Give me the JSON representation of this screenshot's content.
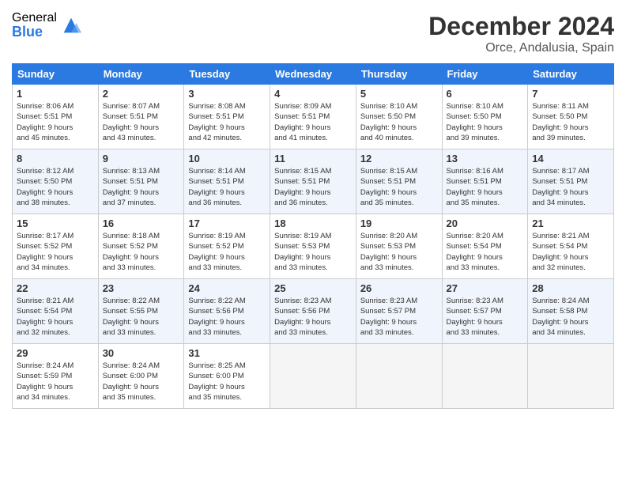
{
  "logo": {
    "general": "General",
    "blue": "Blue"
  },
  "header": {
    "month": "December 2024",
    "location": "Orce, Andalusia, Spain"
  },
  "weekdays": [
    "Sunday",
    "Monday",
    "Tuesday",
    "Wednesday",
    "Thursday",
    "Friday",
    "Saturday"
  ],
  "weeks": [
    [
      {
        "day": "1",
        "info": "Sunrise: 8:06 AM\nSunset: 5:51 PM\nDaylight: 9 hours\nand 45 minutes."
      },
      {
        "day": "2",
        "info": "Sunrise: 8:07 AM\nSunset: 5:51 PM\nDaylight: 9 hours\nand 43 minutes."
      },
      {
        "day": "3",
        "info": "Sunrise: 8:08 AM\nSunset: 5:51 PM\nDaylight: 9 hours\nand 42 minutes."
      },
      {
        "day": "4",
        "info": "Sunrise: 8:09 AM\nSunset: 5:51 PM\nDaylight: 9 hours\nand 41 minutes."
      },
      {
        "day": "5",
        "info": "Sunrise: 8:10 AM\nSunset: 5:50 PM\nDaylight: 9 hours\nand 40 minutes."
      },
      {
        "day": "6",
        "info": "Sunrise: 8:10 AM\nSunset: 5:50 PM\nDaylight: 9 hours\nand 39 minutes."
      },
      {
        "day": "7",
        "info": "Sunrise: 8:11 AM\nSunset: 5:50 PM\nDaylight: 9 hours\nand 39 minutes."
      }
    ],
    [
      {
        "day": "8",
        "info": "Sunrise: 8:12 AM\nSunset: 5:50 PM\nDaylight: 9 hours\nand 38 minutes."
      },
      {
        "day": "9",
        "info": "Sunrise: 8:13 AM\nSunset: 5:51 PM\nDaylight: 9 hours\nand 37 minutes."
      },
      {
        "day": "10",
        "info": "Sunrise: 8:14 AM\nSunset: 5:51 PM\nDaylight: 9 hours\nand 36 minutes."
      },
      {
        "day": "11",
        "info": "Sunrise: 8:15 AM\nSunset: 5:51 PM\nDaylight: 9 hours\nand 36 minutes."
      },
      {
        "day": "12",
        "info": "Sunrise: 8:15 AM\nSunset: 5:51 PM\nDaylight: 9 hours\nand 35 minutes."
      },
      {
        "day": "13",
        "info": "Sunrise: 8:16 AM\nSunset: 5:51 PM\nDaylight: 9 hours\nand 35 minutes."
      },
      {
        "day": "14",
        "info": "Sunrise: 8:17 AM\nSunset: 5:51 PM\nDaylight: 9 hours\nand 34 minutes."
      }
    ],
    [
      {
        "day": "15",
        "info": "Sunrise: 8:17 AM\nSunset: 5:52 PM\nDaylight: 9 hours\nand 34 minutes."
      },
      {
        "day": "16",
        "info": "Sunrise: 8:18 AM\nSunset: 5:52 PM\nDaylight: 9 hours\nand 33 minutes."
      },
      {
        "day": "17",
        "info": "Sunrise: 8:19 AM\nSunset: 5:52 PM\nDaylight: 9 hours\nand 33 minutes."
      },
      {
        "day": "18",
        "info": "Sunrise: 8:19 AM\nSunset: 5:53 PM\nDaylight: 9 hours\nand 33 minutes."
      },
      {
        "day": "19",
        "info": "Sunrise: 8:20 AM\nSunset: 5:53 PM\nDaylight: 9 hours\nand 33 minutes."
      },
      {
        "day": "20",
        "info": "Sunrise: 8:20 AM\nSunset: 5:54 PM\nDaylight: 9 hours\nand 33 minutes."
      },
      {
        "day": "21",
        "info": "Sunrise: 8:21 AM\nSunset: 5:54 PM\nDaylight: 9 hours\nand 32 minutes."
      }
    ],
    [
      {
        "day": "22",
        "info": "Sunrise: 8:21 AM\nSunset: 5:54 PM\nDaylight: 9 hours\nand 32 minutes."
      },
      {
        "day": "23",
        "info": "Sunrise: 8:22 AM\nSunset: 5:55 PM\nDaylight: 9 hours\nand 33 minutes."
      },
      {
        "day": "24",
        "info": "Sunrise: 8:22 AM\nSunset: 5:56 PM\nDaylight: 9 hours\nand 33 minutes."
      },
      {
        "day": "25",
        "info": "Sunrise: 8:23 AM\nSunset: 5:56 PM\nDaylight: 9 hours\nand 33 minutes."
      },
      {
        "day": "26",
        "info": "Sunrise: 8:23 AM\nSunset: 5:57 PM\nDaylight: 9 hours\nand 33 minutes."
      },
      {
        "day": "27",
        "info": "Sunrise: 8:23 AM\nSunset: 5:57 PM\nDaylight: 9 hours\nand 33 minutes."
      },
      {
        "day": "28",
        "info": "Sunrise: 8:24 AM\nSunset: 5:58 PM\nDaylight: 9 hours\nand 34 minutes."
      }
    ],
    [
      {
        "day": "29",
        "info": "Sunrise: 8:24 AM\nSunset: 5:59 PM\nDaylight: 9 hours\nand 34 minutes."
      },
      {
        "day": "30",
        "info": "Sunrise: 8:24 AM\nSunset: 6:00 PM\nDaylight: 9 hours\nand 35 minutes."
      },
      {
        "day": "31",
        "info": "Sunrise: 8:25 AM\nSunset: 6:00 PM\nDaylight: 9 hours\nand 35 minutes."
      },
      null,
      null,
      null,
      null
    ]
  ]
}
